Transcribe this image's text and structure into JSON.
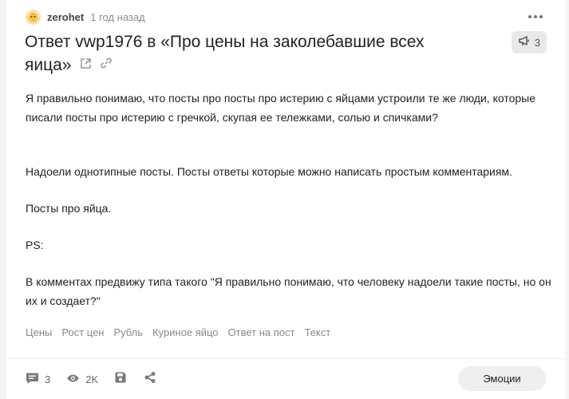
{
  "post": {
    "author": "zerohet",
    "time": "1 год назад",
    "title": "Ответ vwp1976 в «Про цены на заколебавшие всех яица»",
    "comment_count": "3",
    "paragraphs": [
      "Я правильно понимаю, что посты про посты про истерию с яйцами устроили те же люди, которые писали посты про истерию с гречкой, скупая ее тележками, солью и спичками?",
      "Надоели однотипные посты. Посты ответы которые можно написать простым комментариям.",
      "Посты про яйца.",
      "PS:",
      "В комментах предвижу типа такого \"Я правильно понимаю, что человеку надоели такие посты, но он их и создает?\""
    ],
    "tags": [
      "Цены",
      "Рост цен",
      "Рубль",
      "Куриное яйцо",
      "Ответ на пост",
      "Текст"
    ]
  },
  "footer": {
    "comments": "3",
    "views": "2K",
    "emotions_label": "Эмоции"
  },
  "icons": {
    "avatar": "chick-avatar",
    "more": "dots-horizontal-icon",
    "external": "external-link-icon",
    "link": "link-icon",
    "megaphone": "megaphone-icon",
    "comment": "comment-icon",
    "eye": "eye-icon",
    "save": "save-icon",
    "share": "share-icon"
  }
}
